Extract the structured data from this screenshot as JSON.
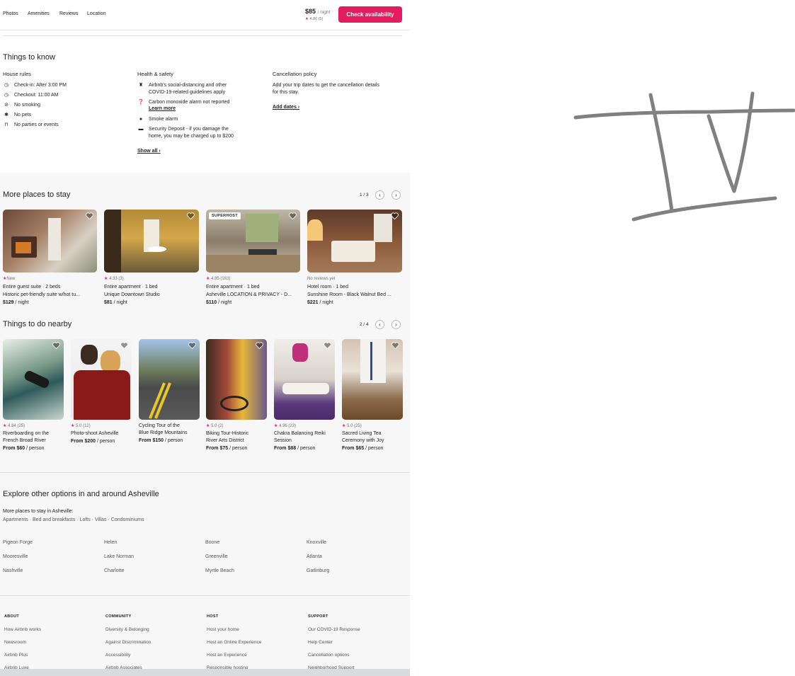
{
  "nav": {
    "links": [
      "Photos",
      "Amenities",
      "Reviews",
      "Location"
    ],
    "price": "$85",
    "per_night": "/ night",
    "rating": "4.80",
    "reviews": "(5)",
    "cta": "Check availability"
  },
  "things_to_know": {
    "title": "Things to know",
    "house_rules": {
      "heading": "House rules",
      "items": [
        "Check-in: After 3:00 PM",
        "Checkout: 11:00 AM",
        "No smoking",
        "No pets",
        "No parties or events"
      ]
    },
    "health": {
      "heading": "Health & safety",
      "items": [
        {
          "line1": "Airbnb's social-distancing and other",
          "line2": "COVID-19-related guidelines apply"
        },
        {
          "line1": "Carbon monoxide alarm not reported",
          "line2": "Learn more"
        },
        {
          "line1": "Smoke alarm",
          "line2": ""
        },
        {
          "line1": "Security Deposit - if you damage the",
          "line2": "home, you may be charged up to $200"
        }
      ],
      "show_all": "Show all"
    },
    "cancellation": {
      "heading": "Cancellation policy",
      "line1": "Add your trip dates to get the cancellation details",
      "line2": "for this stay.",
      "add_dates": "Add dates"
    }
  },
  "more_places": {
    "title": "More places to stay",
    "pager": "1 / 3",
    "superhost_badge": "SUPERHOST",
    "cards": [
      {
        "rating": "New",
        "reviews": "",
        "type": "Entire guest suite · 2 beds",
        "name": "Historic pet-friendly suite w/hot tu...",
        "price": "$129",
        "unit": "/ night"
      },
      {
        "rating": "4.33",
        "reviews": "(3)",
        "type": "Entire apartment · 1 bed",
        "name": "Unique Downtown Studio",
        "price": "$81",
        "unit": "/ night"
      },
      {
        "rating": "4.85",
        "reviews": "(163)",
        "type": "Entire apartment · 1 bed",
        "name": "Asheville LOCATION & PRIVACY - D...",
        "price": "$110",
        "unit": "/ night"
      },
      {
        "rating": "No reviews yet",
        "reviews": "",
        "type": "Hotel room · 1 bed",
        "name": "Sunshine Room - Black Walnut Bed ...",
        "price": "$221",
        "unit": "/ night"
      }
    ]
  },
  "things_to_do": {
    "title": "Things to do nearby",
    "pager": "2 / 4",
    "cards": [
      {
        "rating": "4.84",
        "reviews": "(25)",
        "line1": "Riverboarding on the",
        "line2": "French Broad River",
        "price": "From $60",
        "unit": "/ person"
      },
      {
        "rating": "5.0",
        "reviews": "(12)",
        "line1": "Photo-shoot Asheville",
        "line2": "",
        "price": "From $200",
        "unit": "/ person"
      },
      {
        "rating": "",
        "reviews": "",
        "line1": "Cycling Tour of the",
        "line2": "Blue Ridge Mountains",
        "price": "From $150",
        "unit": "/ person"
      },
      {
        "rating": "5.0",
        "reviews": "(2)",
        "line1": "Biking Tour-Historic",
        "line2": "River Arts District",
        "price": "From $75",
        "unit": "/ person"
      },
      {
        "rating": "4.96",
        "reviews": "(23)",
        "line1": "Chakra Balancing Reiki",
        "line2": "Session",
        "price": "From $88",
        "unit": "/ person"
      },
      {
        "rating": "5.0",
        "reviews": "(25)",
        "line1": "Sacred Living Tea",
        "line2": "Ceremony with Joy",
        "price": "From $65",
        "unit": "/ person"
      }
    ]
  },
  "explore": {
    "title": "Explore other options in and around Asheville",
    "sub": "More places to stay in Asheville:",
    "types": "Apartments · Bed and breakfasts · Lofts · Villas · Condominiums",
    "destinations": [
      "Pigeon Forge",
      "Helen",
      "Boone",
      "Knoxville",
      "Mooresville",
      "Lake Norman",
      "Greenville",
      "Atlanta",
      "Nashville",
      "Charlotte",
      "Myrtle Beach",
      "Gatlinburg"
    ]
  },
  "footer": {
    "columns": [
      {
        "heading": "ABOUT",
        "links": [
          "How Airbnb works",
          "Newsroom",
          "Airbnb Plus",
          "Airbnb Luxe"
        ]
      },
      {
        "heading": "COMMUNITY",
        "links": [
          "Diversity & Belonging",
          "Against Discrimination",
          "Accessibility",
          "Airbnb Associates"
        ]
      },
      {
        "heading": "HOST",
        "links": [
          "Host your home",
          "Host an Online Experience",
          "Host an Experience",
          "Responsible hosting"
        ]
      },
      {
        "heading": "SUPPORT",
        "links": [
          "Our COVID-19 Response",
          "Help Center",
          "Cancellation options",
          "Neighborhood Support"
        ]
      }
    ]
  },
  "colors": {
    "accent": "#e31c5f",
    "text": "#222222",
    "muted": "#717171",
    "section_bg": "#f7f7f7",
    "annotation": "#808080"
  },
  "icons": [
    "clock-icon",
    "no-smoking-icon",
    "no-pets-icon",
    "no-parties-icon",
    "sanitizer-icon",
    "alert-icon",
    "check-circle-icon",
    "card-icon",
    "heart-icon",
    "chevron-left-icon",
    "chevron-right-icon",
    "star-icon"
  ]
}
